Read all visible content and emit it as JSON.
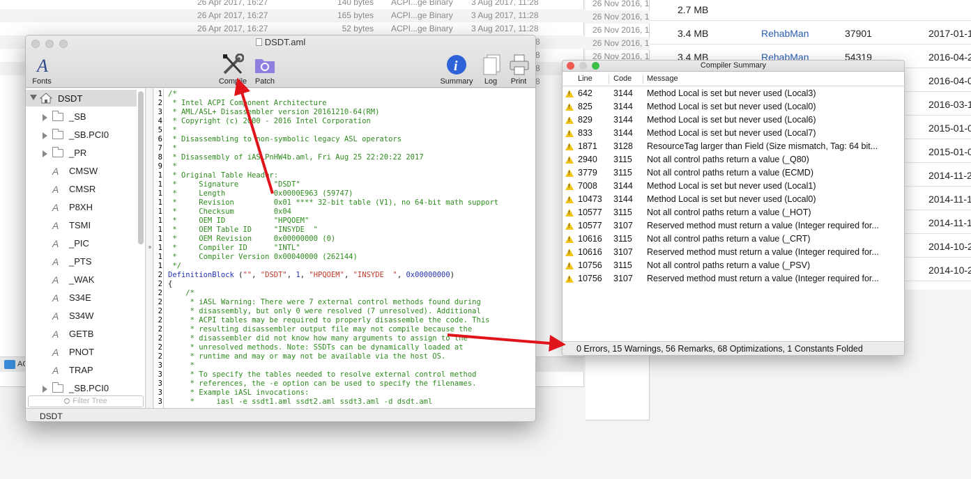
{
  "bg_finder": {
    "rows": [
      {
        "date": "26 Apr 2017, 16:27",
        "size": "140 bytes",
        "kind": "ACPI...ge Binary",
        "added": "3 Aug 2017, 11:28"
      },
      {
        "date": "26 Apr 2017, 16:27",
        "size": "165 bytes",
        "kind": "ACPI...ge Binary",
        "added": "3 Aug 2017, 11:28"
      },
      {
        "date": "26 Apr 2017, 16:27",
        "size": "52 bytes",
        "kind": "ACPI...ge Binary",
        "added": "3 Aug 2017, 11:28"
      }
    ],
    "row_tail": "8",
    "footer_folder": "AC"
  },
  "bg_dates": [
    "26 Nov 2016, 1",
    "26 Nov 2016, 1",
    "26 Nov 2016, 1",
    "26 Nov 2016, 1",
    "26 Nov 2016, 1"
  ],
  "right_table": {
    "rows": [
      {
        "size": "2.7 MB",
        "author": "",
        "id": "",
        "date": ""
      },
      {
        "size": "3.4 MB",
        "author": "RehabMan",
        "id": "37901",
        "date": "2017-01-1"
      },
      {
        "size": "3.4 MB",
        "author": "RehabMan",
        "id": "54319",
        "date": "2016-04-2"
      },
      {
        "size": "",
        "author": "",
        "id": "",
        "date": "2016-04-0"
      },
      {
        "size": "",
        "author": "",
        "id": "",
        "date": "2016-03-1"
      },
      {
        "size": "",
        "author": "",
        "id": "",
        "date": "2015-01-0"
      },
      {
        "size": "",
        "author": "",
        "id": "",
        "date": "2015-01-0"
      },
      {
        "size": "",
        "author": "",
        "id": "",
        "date": "2014-11-2"
      },
      {
        "size": "",
        "author": "",
        "id": "",
        "date": "2014-11-1"
      },
      {
        "size": "",
        "author": "",
        "id": "",
        "date": "2014-11-1"
      },
      {
        "size": "",
        "author": "",
        "id": "",
        "date": "2014-10-2"
      },
      {
        "size": "",
        "author": "",
        "id": "",
        "date": "2014-10-2"
      }
    ]
  },
  "main_window": {
    "title": "DSDT.aml",
    "toolbar": {
      "fonts": "Fonts",
      "compile": "Compile",
      "patch": "Patch",
      "summary": "Summary",
      "log": "Log",
      "print": "Print"
    },
    "tree_root": "DSDT",
    "tree_items": [
      {
        "label": "_SB",
        "type": "folder"
      },
      {
        "label": "_SB.PCI0",
        "type": "folder"
      },
      {
        "label": "_PR",
        "type": "folder"
      },
      {
        "label": "CMSW",
        "type": "method"
      },
      {
        "label": "CMSR",
        "type": "method"
      },
      {
        "label": "P8XH",
        "type": "method"
      },
      {
        "label": "TSMI",
        "type": "method"
      },
      {
        "label": "_PIC",
        "type": "method"
      },
      {
        "label": "_PTS",
        "type": "method"
      },
      {
        "label": "_WAK",
        "type": "method"
      },
      {
        "label": "S34E",
        "type": "method"
      },
      {
        "label": "S34W",
        "type": "method"
      },
      {
        "label": "GETB",
        "type": "method"
      },
      {
        "label": "PNOT",
        "type": "method"
      },
      {
        "label": "TRAP",
        "type": "method"
      },
      {
        "label": "_SB.PCI0",
        "type": "folder"
      }
    ],
    "filter_placeholder": "Filter Tree",
    "status": "DSDT",
    "method_glyph": "A",
    "line_numbers": [
      "1",
      "2",
      "3",
      "4",
      "5",
      "6",
      "7",
      "8",
      "9",
      "1",
      "1",
      "1",
      "1",
      "1",
      "1",
      "1",
      "1",
      "1",
      "1",
      "1",
      "2",
      "2",
      "2",
      "2",
      "2",
      "2",
      "2",
      "2",
      "2",
      "2",
      "3",
      "3",
      "3",
      "3",
      "3"
    ],
    "code_lines": [
      "/*",
      " * Intel ACPI Component Architecture",
      " * AML/ASL+ Disassembler version 20161210-64(RM)",
      " * Copyright (c) 2000 - 2016 Intel Corporation",
      " *",
      " * Disassembling to non-symbolic legacy ASL operators",
      " *",
      " * Disassembly of iASLPnHW4b.aml, Fri Aug 25 22:20:22 2017",
      " *",
      " * Original Table Header:",
      " *     Signature        \"DSDT\"",
      " *     Length           0x0000E963 (59747)",
      " *     Revision         0x01 **** 32-bit table (V1), no 64-bit math support",
      " *     Checksum         0x04",
      " *     OEM ID           \"HPQOEM\"",
      " *     OEM Table ID     \"INSYDE  \"",
      " *     OEM Revision     0x00000000 (0)",
      " *     Compiler ID      \"INTL\"",
      " *     Compiler Version 0x00040000 (262144)",
      " */"
    ],
    "definition_block": {
      "keyword": "DefinitionBlock",
      "args": [
        "\"\"",
        "\"DSDT\"",
        "1",
        "\"HPQOEM\"",
        "\"INSYDE  \"",
        "0x00000000"
      ]
    },
    "brace": "{",
    "comment_lines": [
      "    /*",
      "     * iASL Warning: There were 7 external control methods found during",
      "     * disassembly, but only 0 were resolved (7 unresolved). Additional",
      "     * ACPI tables may be required to properly disassemble the code. This",
      "     * resulting disassembler output file may not compile because the",
      "     * disassembler did not know how many arguments to assign to the",
      "     * unresolved methods. Note: SSDTs can be dynamically loaded at",
      "     * runtime and may or may not be available via the host OS.",
      "     *",
      "     * To specify the tables needed to resolve external control method",
      "     * references, the -e option can be used to specify the filenames.",
      "     * Example iASL invocations:",
      "     *     iasl -e ssdt1.aml ssdt2.aml ssdt3.aml -d dsdt.aml"
    ]
  },
  "compiler_summary": {
    "title": "Compiler Summary",
    "headers": {
      "line": "Line",
      "code": "Code",
      "message": "Message"
    },
    "rows": [
      {
        "line": "642",
        "code": "3144",
        "message": "Method Local is set but never used (Local3)"
      },
      {
        "line": "825",
        "code": "3144",
        "message": "Method Local is set but never used (Local0)"
      },
      {
        "line": "829",
        "code": "3144",
        "message": "Method Local is set but never used (Local6)"
      },
      {
        "line": "833",
        "code": "3144",
        "message": "Method Local is set but never used (Local7)"
      },
      {
        "line": "1871",
        "code": "3128",
        "message": "ResourceTag larger than Field (Size mismatch, Tag: 64 bit..."
      },
      {
        "line": "2940",
        "code": "3115",
        "message": "Not all control paths return a value (_Q80)"
      },
      {
        "line": "3779",
        "code": "3115",
        "message": "Not all control paths return a value (ECMD)"
      },
      {
        "line": "7008",
        "code": "3144",
        "message": "Method Local is set but never used (Local1)"
      },
      {
        "line": "10473",
        "code": "3144",
        "message": "Method Local is set but never used (Local0)"
      },
      {
        "line": "10577",
        "code": "3115",
        "message": "Not all control paths return a value (_HOT)"
      },
      {
        "line": "10577",
        "code": "3107",
        "message": "Reserved method must return a value (Integer required for..."
      },
      {
        "line": "10616",
        "code": "3115",
        "message": "Not all control paths return a value (_CRT)"
      },
      {
        "line": "10616",
        "code": "3107",
        "message": "Reserved method must return a value (Integer required for..."
      },
      {
        "line": "10756",
        "code": "3115",
        "message": "Not all control paths return a value (_PSV)"
      },
      {
        "line": "10756",
        "code": "3107",
        "message": "Reserved method must return a value (Integer required for..."
      }
    ],
    "footer": "0 Errors, 15 Warnings, 56 Remarks, 68 Optimizations, 1 Constants Folded"
  },
  "colors": {
    "arrow": "#e0141b",
    "summary_icon": "#2e63d8",
    "patch_icon": "#8e7ee0",
    "code_comment": "#2e8b1e",
    "warning_icon": "#f0c419"
  }
}
